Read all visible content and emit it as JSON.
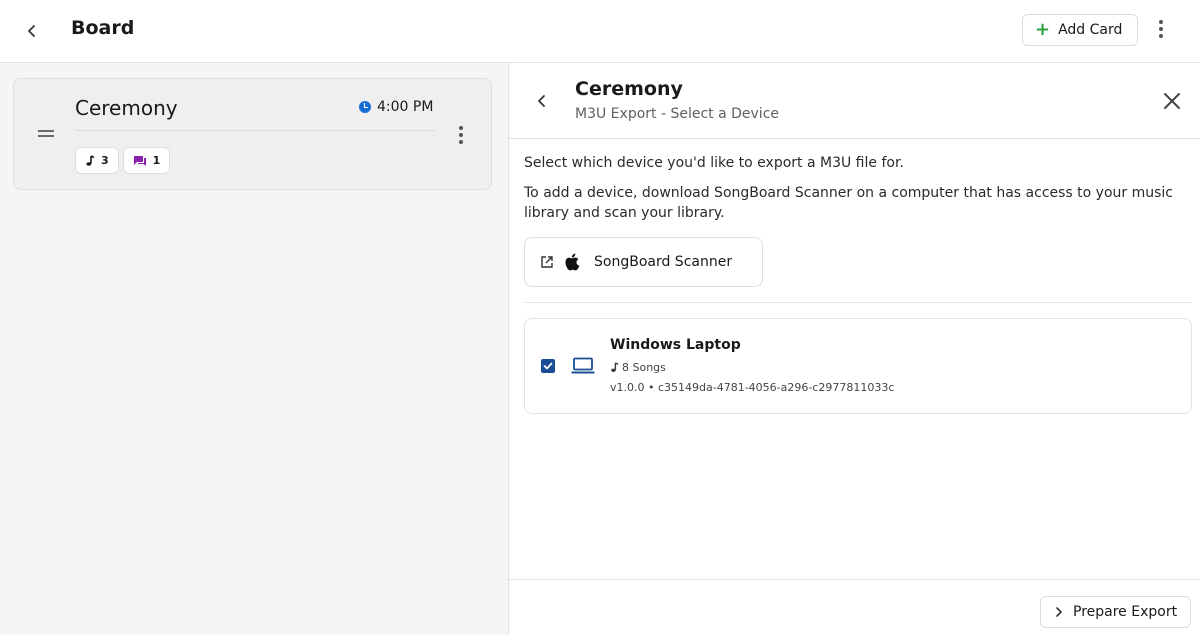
{
  "header": {
    "back_icon": "chevron-left-icon",
    "title": "Board",
    "add_card_label": "Add Card",
    "add_icon": "plus-icon",
    "menu_icon": "more-vertical-icon"
  },
  "board": {
    "card": {
      "title": "Ceremony",
      "time": "4:00 PM",
      "songs_count": "3",
      "comments_count": "1"
    }
  },
  "panel": {
    "title": "Ceremony",
    "subtitle": "M3U Export - Select a Device",
    "intro_1": "Select which device you'd like to export a M3U file for.",
    "intro_2": "To add a device, download SongBoard Scanner on a computer that has access to your music library and scan your library.",
    "scanner_label": "SongBoard Scanner",
    "device": {
      "name": "Windows Laptop",
      "songs": "8 Songs",
      "meta": "v1.0.0 • c35149da-4781-4056-a296-c2977811033c",
      "checked": true
    },
    "footer": {
      "export_label": "Prepare Export"
    }
  },
  "colors": {
    "accent_green": "#2e9e3e",
    "clock_blue": "#1a6ed8",
    "comment_purple": "#8a1fb0",
    "checkbox_blue": "#1b4f95",
    "laptop_blue": "#1b4f95"
  }
}
